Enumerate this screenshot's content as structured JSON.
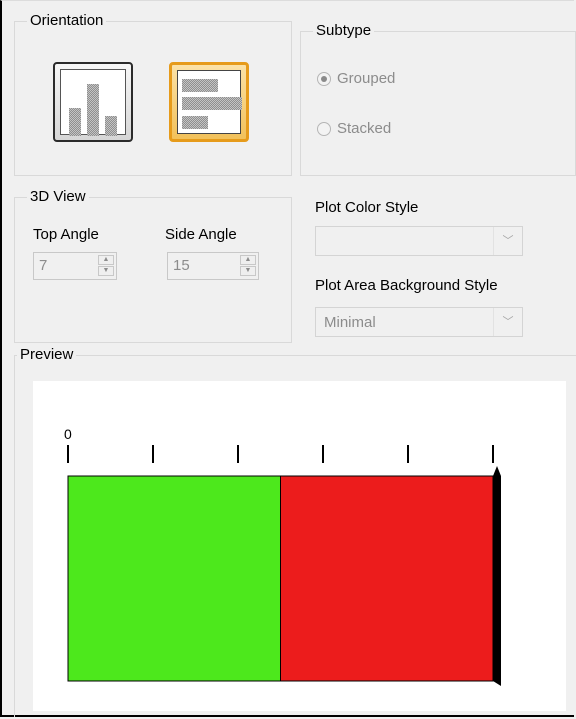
{
  "orientation": {
    "title": "Orientation",
    "buttons": [
      {
        "name": "vertical-bars",
        "selected": false
      },
      {
        "name": "horizontal-bars",
        "selected": true
      }
    ]
  },
  "subtype": {
    "title": "Subtype",
    "options": [
      {
        "label": "Grouped",
        "checked": true
      },
      {
        "label": "Stacked",
        "checked": false
      }
    ]
  },
  "view3d": {
    "title": "3D View",
    "top_angle_label": "Top Angle",
    "top_angle_value": "7",
    "side_angle_label": "Side Angle",
    "side_angle_value": "15"
  },
  "plot_color": {
    "label": "Plot Color Style",
    "value": ""
  },
  "plot_background": {
    "label": "Plot Area Background Style",
    "value": "Minimal"
  },
  "preview": {
    "title": "Preview"
  },
  "chart_data": {
    "type": "bar",
    "orientation": "horizontal",
    "stacked": true,
    "tick_labels": [
      "0"
    ],
    "tick_count": 6,
    "series": [
      {
        "value": 1,
        "color": "#4de81c"
      },
      {
        "value": 1,
        "color": "#ec1c1c"
      }
    ],
    "xlim": [
      0,
      2
    ],
    "grid": false
  },
  "colors": {
    "selected_border": "#e69b1b",
    "selected_fill": "#f4c55f",
    "series_green": "#4de81c",
    "series_red": "#ec1c1c"
  }
}
